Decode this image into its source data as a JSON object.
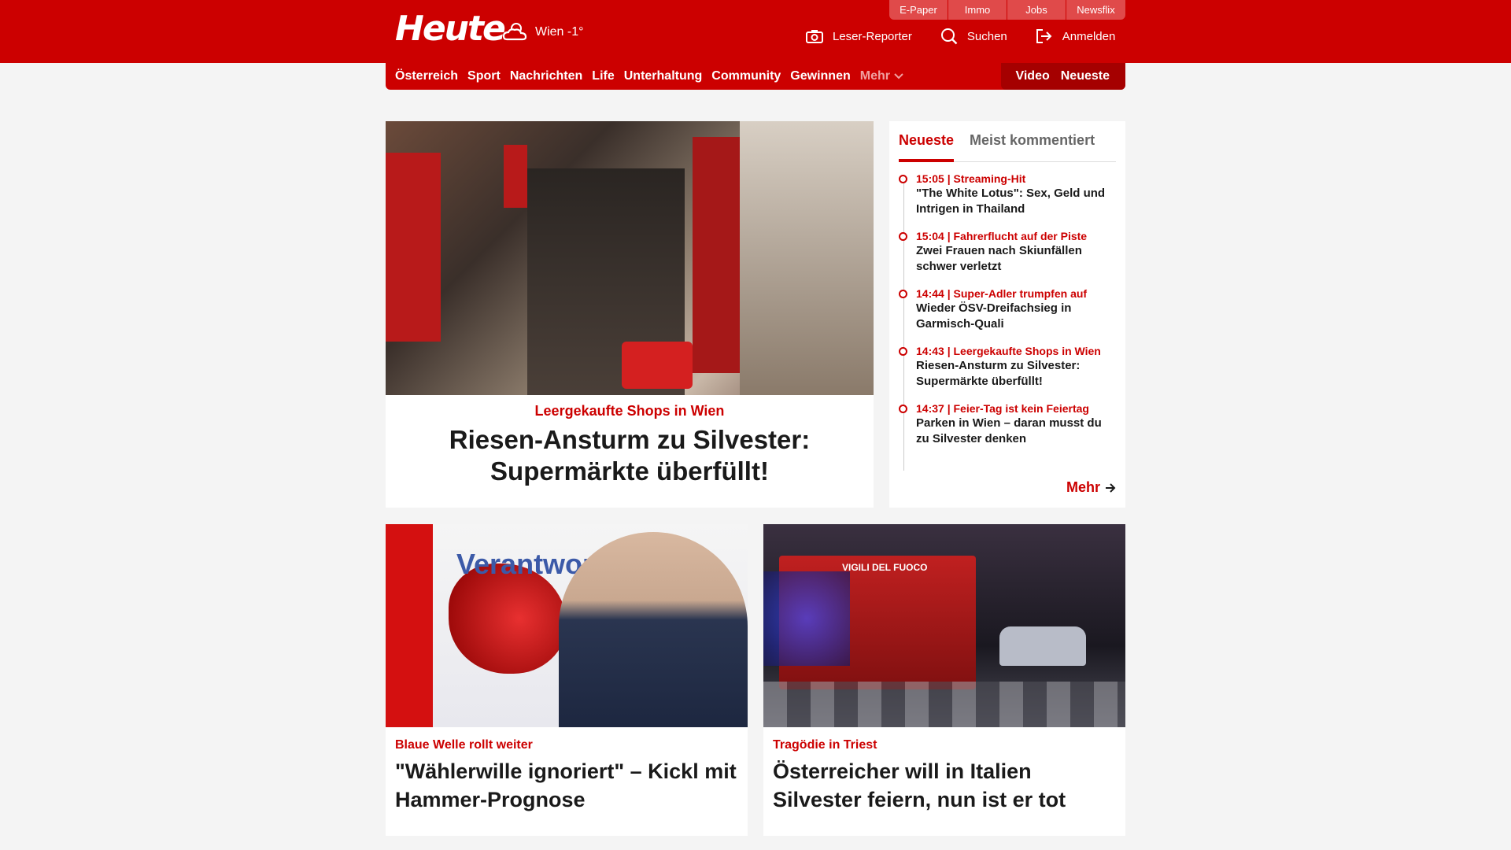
{
  "header": {
    "logo": "Heute",
    "weather": "Wien -1°",
    "service_tabs": [
      "E-Paper",
      "Immo",
      "Jobs",
      "Newsflix"
    ],
    "actions": [
      {
        "label": "Leser-Reporter",
        "icon": "camera-icon"
      },
      {
        "label": "Suchen",
        "icon": "search-icon"
      },
      {
        "label": "Anmelden",
        "icon": "login-icon"
      }
    ]
  },
  "nav": {
    "items": [
      "Österreich",
      "Sport",
      "Nachrichten",
      "Life",
      "Unterhaltung",
      "Community",
      "Gewinnen"
    ],
    "more": "Mehr",
    "right": [
      "Video",
      "Neueste"
    ]
  },
  "hero": {
    "kicker": "Leergekaufte Shops in Wien",
    "title": "Riesen-Ansturm zu Silvester: Supermärkte überfüllt!"
  },
  "sidebar": {
    "tabs": [
      "Neueste",
      "Meist kommentiert"
    ],
    "items": [
      {
        "meta": "15:05 | Streaming-Hit",
        "title": "\"The White Lotus\": Sex, Geld und Intrigen in Thailand"
      },
      {
        "meta": "15:04 | Fahrerflucht auf der Piste",
        "title": "Zwei Frauen nach Skiunfällen schwer verletzt"
      },
      {
        "meta": "14:44 | Super-Adler trumpfen auf",
        "title": "Wieder ÖSV-Dreifachsieg in Garmisch-Quali"
      },
      {
        "meta": "14:43 | Leergekaufte Shops in Wien",
        "title": "Riesen-Ansturm zu Silvester: Supermärkte überfüllt!"
      },
      {
        "meta": "14:37 | Feier-Tag ist kein Feiertag",
        "title": "Parken in Wien – daran musst du zu Silvester denken"
      }
    ],
    "more": "Mehr"
  },
  "cards": [
    {
      "kicker": "Blaue Welle rollt weiter",
      "title": "\"Wählerwille ignoriert\" – Kickl mit Hammer-Prognose",
      "img_text": "Verantwortung für"
    },
    {
      "kicker": "Tragödie in Triest",
      "title": "Österreicher will in Italien Silvester feiern, nun ist er tot",
      "img_text": "VIGILI DEL FUOCO"
    }
  ],
  "colors": {
    "brand_red": "#cc0000",
    "dark_red": "#a50000",
    "background": "#f4f4f4"
  }
}
